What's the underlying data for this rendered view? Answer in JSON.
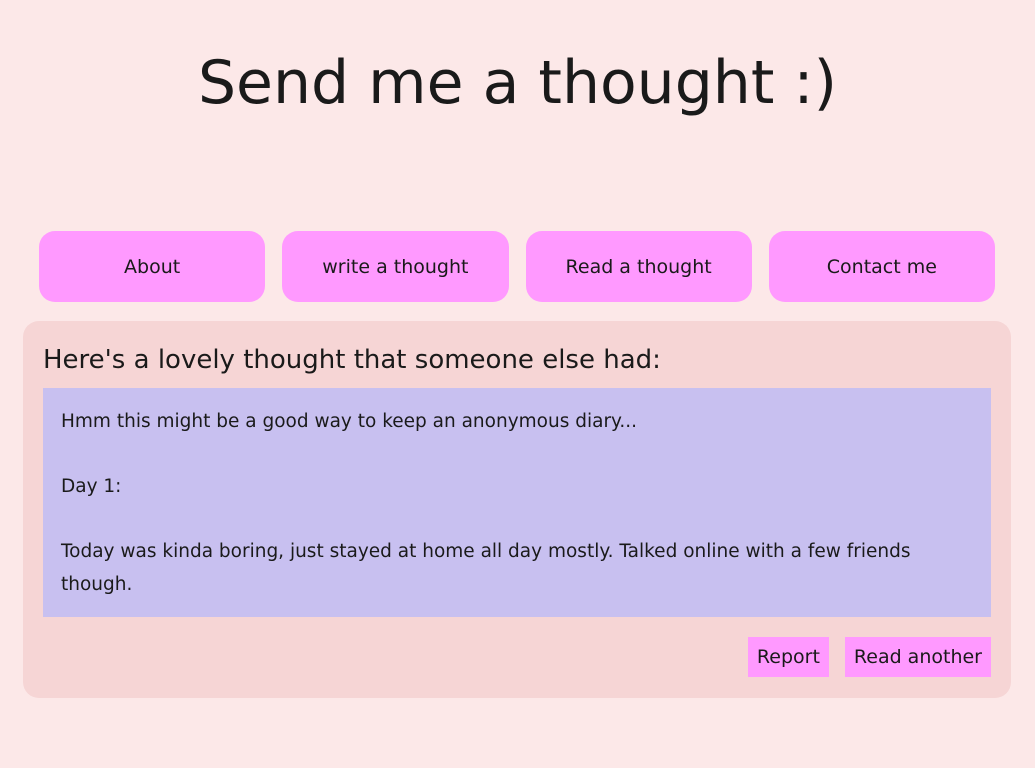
{
  "site": {
    "title": "Send me a thought :)"
  },
  "nav": {
    "items": [
      {
        "label": "About"
      },
      {
        "label": "write a thought"
      },
      {
        "label": "Read a thought"
      },
      {
        "label": "Contact me"
      }
    ]
  },
  "panel": {
    "heading": "Here's a lovely thought that someone else had:",
    "thought": {
      "line1": "Hmm this might be a good way to keep an anonymous diary...",
      "line2": "Day 1:",
      "line3": "Today was kinda boring, just stayed at home all day mostly. Talked online with a few friends though."
    },
    "actions": {
      "report_label": "Report",
      "read_another_label": "Read another"
    }
  },
  "colors": {
    "background": "#fce8e8",
    "button": "#ff99ff",
    "panel": "#f6d5d5",
    "thought_box": "#c8c0f0"
  }
}
